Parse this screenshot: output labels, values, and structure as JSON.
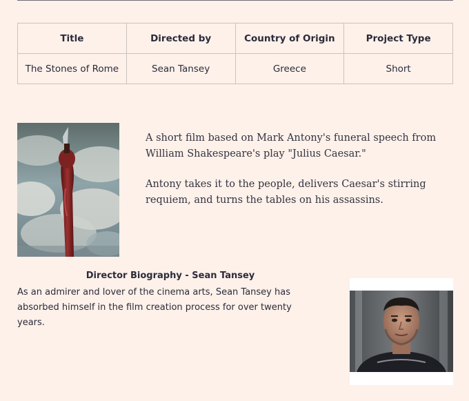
{
  "table": {
    "headers": [
      "Title",
      "Directed by",
      "Country of Origin",
      "Project Type"
    ],
    "rows": [
      [
        "The Stones of Rome",
        "Sean Tansey",
        "Greece",
        "Short"
      ]
    ]
  },
  "synopsis": {
    "paragraph1": "A short film based on Mark Antony's funeral speech from William Shakespeare's play \"Julius Caesar.\"",
    "paragraph2": "Antony takes it to the people, delivers Caesar's stirring requiem, and turns the tables on his assassins."
  },
  "bio": {
    "heading": "Director Biography - Sean Tansey",
    "text": "As an admirer and lover of the cinema arts, Sean Tansey has absorbed himself in the film creation process for over twenty years."
  },
  "colors": {
    "background": "#fdf1ea",
    "border": "#c9c2bf",
    "text": "#2b2b3a"
  }
}
